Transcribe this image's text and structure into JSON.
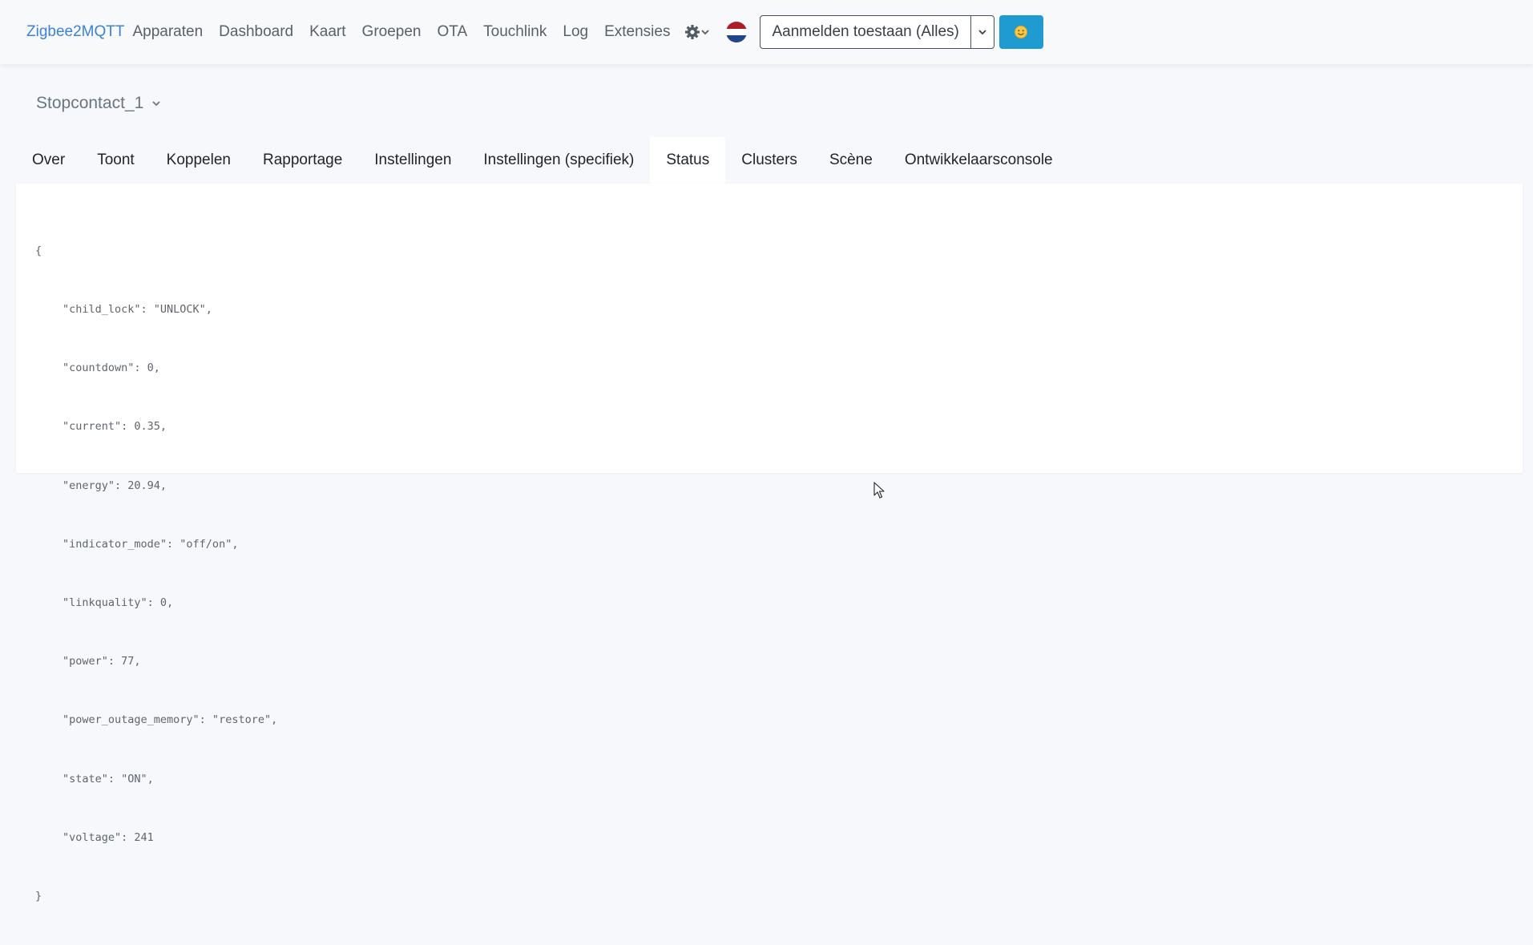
{
  "navbar": {
    "brand": "Zigbee2MQTT",
    "links": [
      "Apparaten",
      "Dashboard",
      "Kaart",
      "Groepen",
      "OTA",
      "Touchlink",
      "Log",
      "Extensies"
    ],
    "settings_icon": "gear-icon",
    "language_flag": "netherlands-flag",
    "permit_join_label": "Aanmelden toestaan (Alles)",
    "theme_icon": "sun-icon",
    "accent_color": "#3b82d6",
    "theme_button_color": "#1f9bd1"
  },
  "device": {
    "name": "Stopcontact_1"
  },
  "tabs": [
    {
      "label": "Over",
      "active": false
    },
    {
      "label": "Toont",
      "active": false
    },
    {
      "label": "Koppelen",
      "active": false
    },
    {
      "label": "Rapportage",
      "active": false
    },
    {
      "label": "Instellingen",
      "active": false
    },
    {
      "label": "Instellingen (specifiek)",
      "active": false
    },
    {
      "label": "Status",
      "active": true
    },
    {
      "label": "Clusters",
      "active": false
    },
    {
      "label": "Scène",
      "active": false
    },
    {
      "label": "Ontwikkelaarsconsole",
      "active": false
    }
  ],
  "status_json": {
    "open": "{",
    "lines": [
      "\"child_lock\": \"UNLOCK\",",
      "\"countdown\": 0,",
      "\"current\": 0.35,",
      "\"energy\": 20.94,",
      "\"indicator_mode\": \"off/on\",",
      "\"linkquality\": 0,",
      "\"power\": 77,",
      "\"power_outage_memory\": \"restore\",",
      "\"state\": \"ON\",",
      "\"voltage\": 241"
    ],
    "close": "}"
  }
}
